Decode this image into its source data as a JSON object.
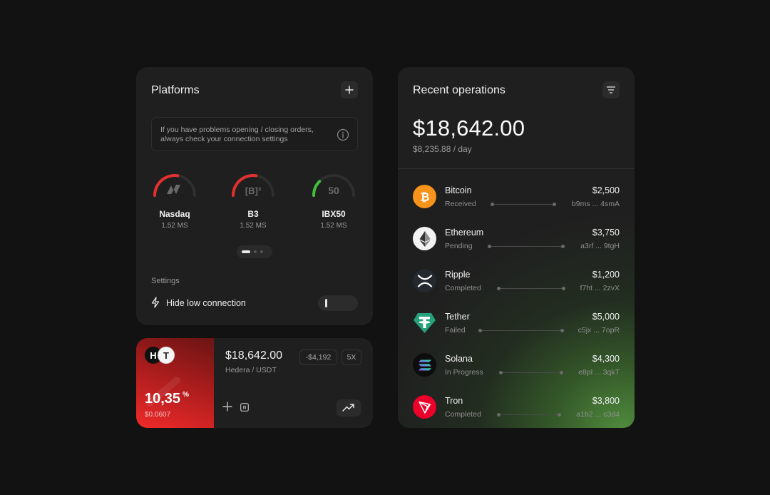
{
  "platforms": {
    "title": "Platforms",
    "notice": "If you have problems opening / closing orders, always check your connection settings",
    "gauges": [
      {
        "name": "Nasdaq",
        "latency": "1.52 MS",
        "level": 0.55,
        "color": "#e23030",
        "icon": "nasdaq-logo"
      },
      {
        "name": "B3",
        "latency": "1.52 MS",
        "level": 0.55,
        "color": "#e23030",
        "icon": "b3-logo",
        "logo_text": "[B]³"
      },
      {
        "name": "IBX50",
        "latency": "1.52 MS",
        "level": 0.25,
        "color": "#3fbf3a",
        "icon": "ibx50-logo",
        "logo_text": "50"
      }
    ],
    "pager": {
      "pages": 3,
      "active": 1
    },
    "settings_label": "Settings",
    "setting": {
      "label": "Hide low connection",
      "enabled": false,
      "icon": "bolt-icon"
    }
  },
  "trade": {
    "coin_a": "H",
    "coin_b": "T",
    "percent": "10,35",
    "percent_unit": "%",
    "percent_sub": "$0.0607",
    "price": "$18,642.00",
    "pair": "Hedera / USDT",
    "change": "-$4,192",
    "leverage": "5X",
    "accent": "#e82828"
  },
  "operations": {
    "title": "Recent operations",
    "total": "$18,642.00",
    "per_day": "$8,235.88 / day",
    "items": [
      {
        "name": "Bitcoin",
        "status": "Received",
        "amount": "$2,500",
        "address": "b9ms ... 4smA",
        "logo": "bitcoin-icon",
        "color": "#f7931a"
      },
      {
        "name": "Ethereum",
        "status": "Pending",
        "amount": "$3,750",
        "address": "a3rf ... 9tgH",
        "logo": "ethereum-icon",
        "color": "#f2f2f2"
      },
      {
        "name": "Ripple",
        "status": "Completed",
        "amount": "$1,200",
        "address": "f7ht ... 2zvX",
        "logo": "ripple-icon",
        "color": "#23292f"
      },
      {
        "name": "Tether",
        "status": "Failed",
        "amount": "$5,000",
        "address": "c5jx ... 7opR",
        "logo": "tether-icon",
        "color": "#26a17b"
      },
      {
        "name": "Solana",
        "status": "In Progress",
        "amount": "$4,300",
        "address": "e8pl ... 3qkT",
        "logo": "solana-icon",
        "color": "#0d0d0d"
      },
      {
        "name": "Tron",
        "status": "Completed",
        "amount": "$3,800",
        "address": "a1b2 ... c3d4",
        "logo": "tron-icon",
        "color": "#eb0029"
      }
    ]
  }
}
